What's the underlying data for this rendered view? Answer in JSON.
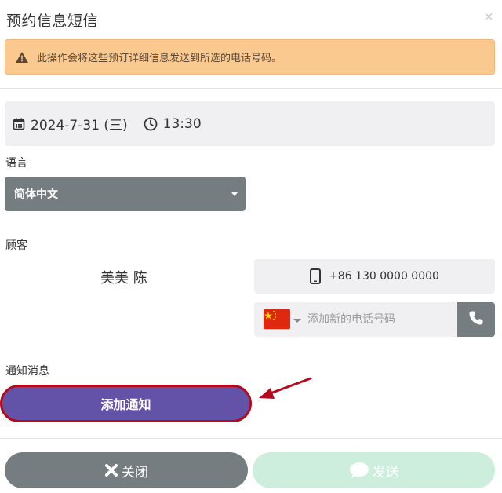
{
  "dialog": {
    "title": "预约信息短信",
    "close_glyph": "×"
  },
  "warning": {
    "icon": "warning-triangle-icon",
    "text": "此操作会将这些预订详细信息发送到所选的电话号码。",
    "bg_color": "#f9c990"
  },
  "appointment": {
    "date_icon": "calendar-icon",
    "date": "2024-7-31 (三)",
    "time_icon": "clock-icon",
    "time": "13:30"
  },
  "language": {
    "label": "语言",
    "selected": "简体中文"
  },
  "customer": {
    "label": "顾客",
    "name": "美美 陈",
    "phone_icon": "mobile-phone-icon",
    "phone": "+86 130 0000 0000",
    "new_phone": {
      "flag": "china-flag-icon",
      "placeholder": "添加新的电话号码",
      "call_icon": "phone-icon"
    }
  },
  "notification": {
    "label": "通知消息",
    "add_button": "添加通知",
    "accent_color": "#6353a8",
    "highlight_color": "#b5091c"
  },
  "footer": {
    "close_button": "关闭",
    "close_icon": "x-icon",
    "send_button": "发送",
    "send_icon": "chat-bubble-icon",
    "send_color": "#cdeedd"
  }
}
